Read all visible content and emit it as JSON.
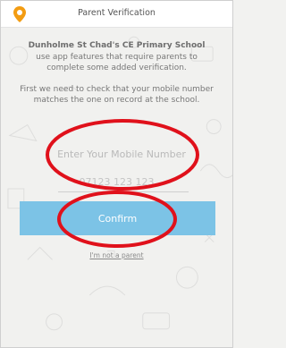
{
  "header": {
    "title": "Parent Verification",
    "icon": "location-pin-icon",
    "accent_color": "#f39c12"
  },
  "main": {
    "school_name": "Dunholme St Chad's CE Primary School",
    "intro": "use app features that require parents to complete some added verification.",
    "check_text": "First we need to check that your mobile number matches the one on record at the school.",
    "mobile_placeholder": "Enter Your Mobile Number",
    "example_number": "07123 123 123",
    "confirm_label": "Confirm",
    "not_parent_label": "I'm not a parent"
  },
  "colors": {
    "button": "#7cc3e6",
    "annotation": "#e0111b"
  }
}
